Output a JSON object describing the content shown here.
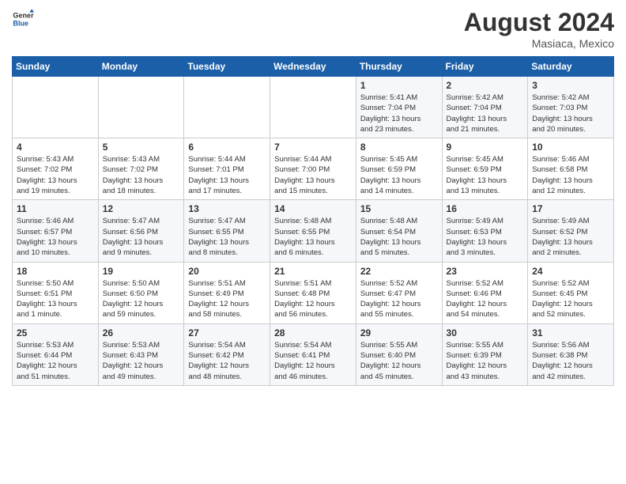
{
  "header": {
    "logo_line1": "General",
    "logo_line2": "Blue",
    "month_year": "August 2024",
    "location": "Masiaca, Mexico"
  },
  "weekdays": [
    "Sunday",
    "Monday",
    "Tuesday",
    "Wednesday",
    "Thursday",
    "Friday",
    "Saturday"
  ],
  "weeks": [
    [
      {
        "day": "",
        "info": ""
      },
      {
        "day": "",
        "info": ""
      },
      {
        "day": "",
        "info": ""
      },
      {
        "day": "",
        "info": ""
      },
      {
        "day": "1",
        "info": "Sunrise: 5:41 AM\nSunset: 7:04 PM\nDaylight: 13 hours\nand 23 minutes."
      },
      {
        "day": "2",
        "info": "Sunrise: 5:42 AM\nSunset: 7:04 PM\nDaylight: 13 hours\nand 21 minutes."
      },
      {
        "day": "3",
        "info": "Sunrise: 5:42 AM\nSunset: 7:03 PM\nDaylight: 13 hours\nand 20 minutes."
      }
    ],
    [
      {
        "day": "4",
        "info": "Sunrise: 5:43 AM\nSunset: 7:02 PM\nDaylight: 13 hours\nand 19 minutes."
      },
      {
        "day": "5",
        "info": "Sunrise: 5:43 AM\nSunset: 7:02 PM\nDaylight: 13 hours\nand 18 minutes."
      },
      {
        "day": "6",
        "info": "Sunrise: 5:44 AM\nSunset: 7:01 PM\nDaylight: 13 hours\nand 17 minutes."
      },
      {
        "day": "7",
        "info": "Sunrise: 5:44 AM\nSunset: 7:00 PM\nDaylight: 13 hours\nand 15 minutes."
      },
      {
        "day": "8",
        "info": "Sunrise: 5:45 AM\nSunset: 6:59 PM\nDaylight: 13 hours\nand 14 minutes."
      },
      {
        "day": "9",
        "info": "Sunrise: 5:45 AM\nSunset: 6:59 PM\nDaylight: 13 hours\nand 13 minutes."
      },
      {
        "day": "10",
        "info": "Sunrise: 5:46 AM\nSunset: 6:58 PM\nDaylight: 13 hours\nand 12 minutes."
      }
    ],
    [
      {
        "day": "11",
        "info": "Sunrise: 5:46 AM\nSunset: 6:57 PM\nDaylight: 13 hours\nand 10 minutes."
      },
      {
        "day": "12",
        "info": "Sunrise: 5:47 AM\nSunset: 6:56 PM\nDaylight: 13 hours\nand 9 minutes."
      },
      {
        "day": "13",
        "info": "Sunrise: 5:47 AM\nSunset: 6:55 PM\nDaylight: 13 hours\nand 8 minutes."
      },
      {
        "day": "14",
        "info": "Sunrise: 5:48 AM\nSunset: 6:55 PM\nDaylight: 13 hours\nand 6 minutes."
      },
      {
        "day": "15",
        "info": "Sunrise: 5:48 AM\nSunset: 6:54 PM\nDaylight: 13 hours\nand 5 minutes."
      },
      {
        "day": "16",
        "info": "Sunrise: 5:49 AM\nSunset: 6:53 PM\nDaylight: 13 hours\nand 3 minutes."
      },
      {
        "day": "17",
        "info": "Sunrise: 5:49 AM\nSunset: 6:52 PM\nDaylight: 13 hours\nand 2 minutes."
      }
    ],
    [
      {
        "day": "18",
        "info": "Sunrise: 5:50 AM\nSunset: 6:51 PM\nDaylight: 13 hours\nand 1 minute."
      },
      {
        "day": "19",
        "info": "Sunrise: 5:50 AM\nSunset: 6:50 PM\nDaylight: 12 hours\nand 59 minutes."
      },
      {
        "day": "20",
        "info": "Sunrise: 5:51 AM\nSunset: 6:49 PM\nDaylight: 12 hours\nand 58 minutes."
      },
      {
        "day": "21",
        "info": "Sunrise: 5:51 AM\nSunset: 6:48 PM\nDaylight: 12 hours\nand 56 minutes."
      },
      {
        "day": "22",
        "info": "Sunrise: 5:52 AM\nSunset: 6:47 PM\nDaylight: 12 hours\nand 55 minutes."
      },
      {
        "day": "23",
        "info": "Sunrise: 5:52 AM\nSunset: 6:46 PM\nDaylight: 12 hours\nand 54 minutes."
      },
      {
        "day": "24",
        "info": "Sunrise: 5:52 AM\nSunset: 6:45 PM\nDaylight: 12 hours\nand 52 minutes."
      }
    ],
    [
      {
        "day": "25",
        "info": "Sunrise: 5:53 AM\nSunset: 6:44 PM\nDaylight: 12 hours\nand 51 minutes."
      },
      {
        "day": "26",
        "info": "Sunrise: 5:53 AM\nSunset: 6:43 PM\nDaylight: 12 hours\nand 49 minutes."
      },
      {
        "day": "27",
        "info": "Sunrise: 5:54 AM\nSunset: 6:42 PM\nDaylight: 12 hours\nand 48 minutes."
      },
      {
        "day": "28",
        "info": "Sunrise: 5:54 AM\nSunset: 6:41 PM\nDaylight: 12 hours\nand 46 minutes."
      },
      {
        "day": "29",
        "info": "Sunrise: 5:55 AM\nSunset: 6:40 PM\nDaylight: 12 hours\nand 45 minutes."
      },
      {
        "day": "30",
        "info": "Sunrise: 5:55 AM\nSunset: 6:39 PM\nDaylight: 12 hours\nand 43 minutes."
      },
      {
        "day": "31",
        "info": "Sunrise: 5:56 AM\nSunset: 6:38 PM\nDaylight: 12 hours\nand 42 minutes."
      }
    ]
  ]
}
